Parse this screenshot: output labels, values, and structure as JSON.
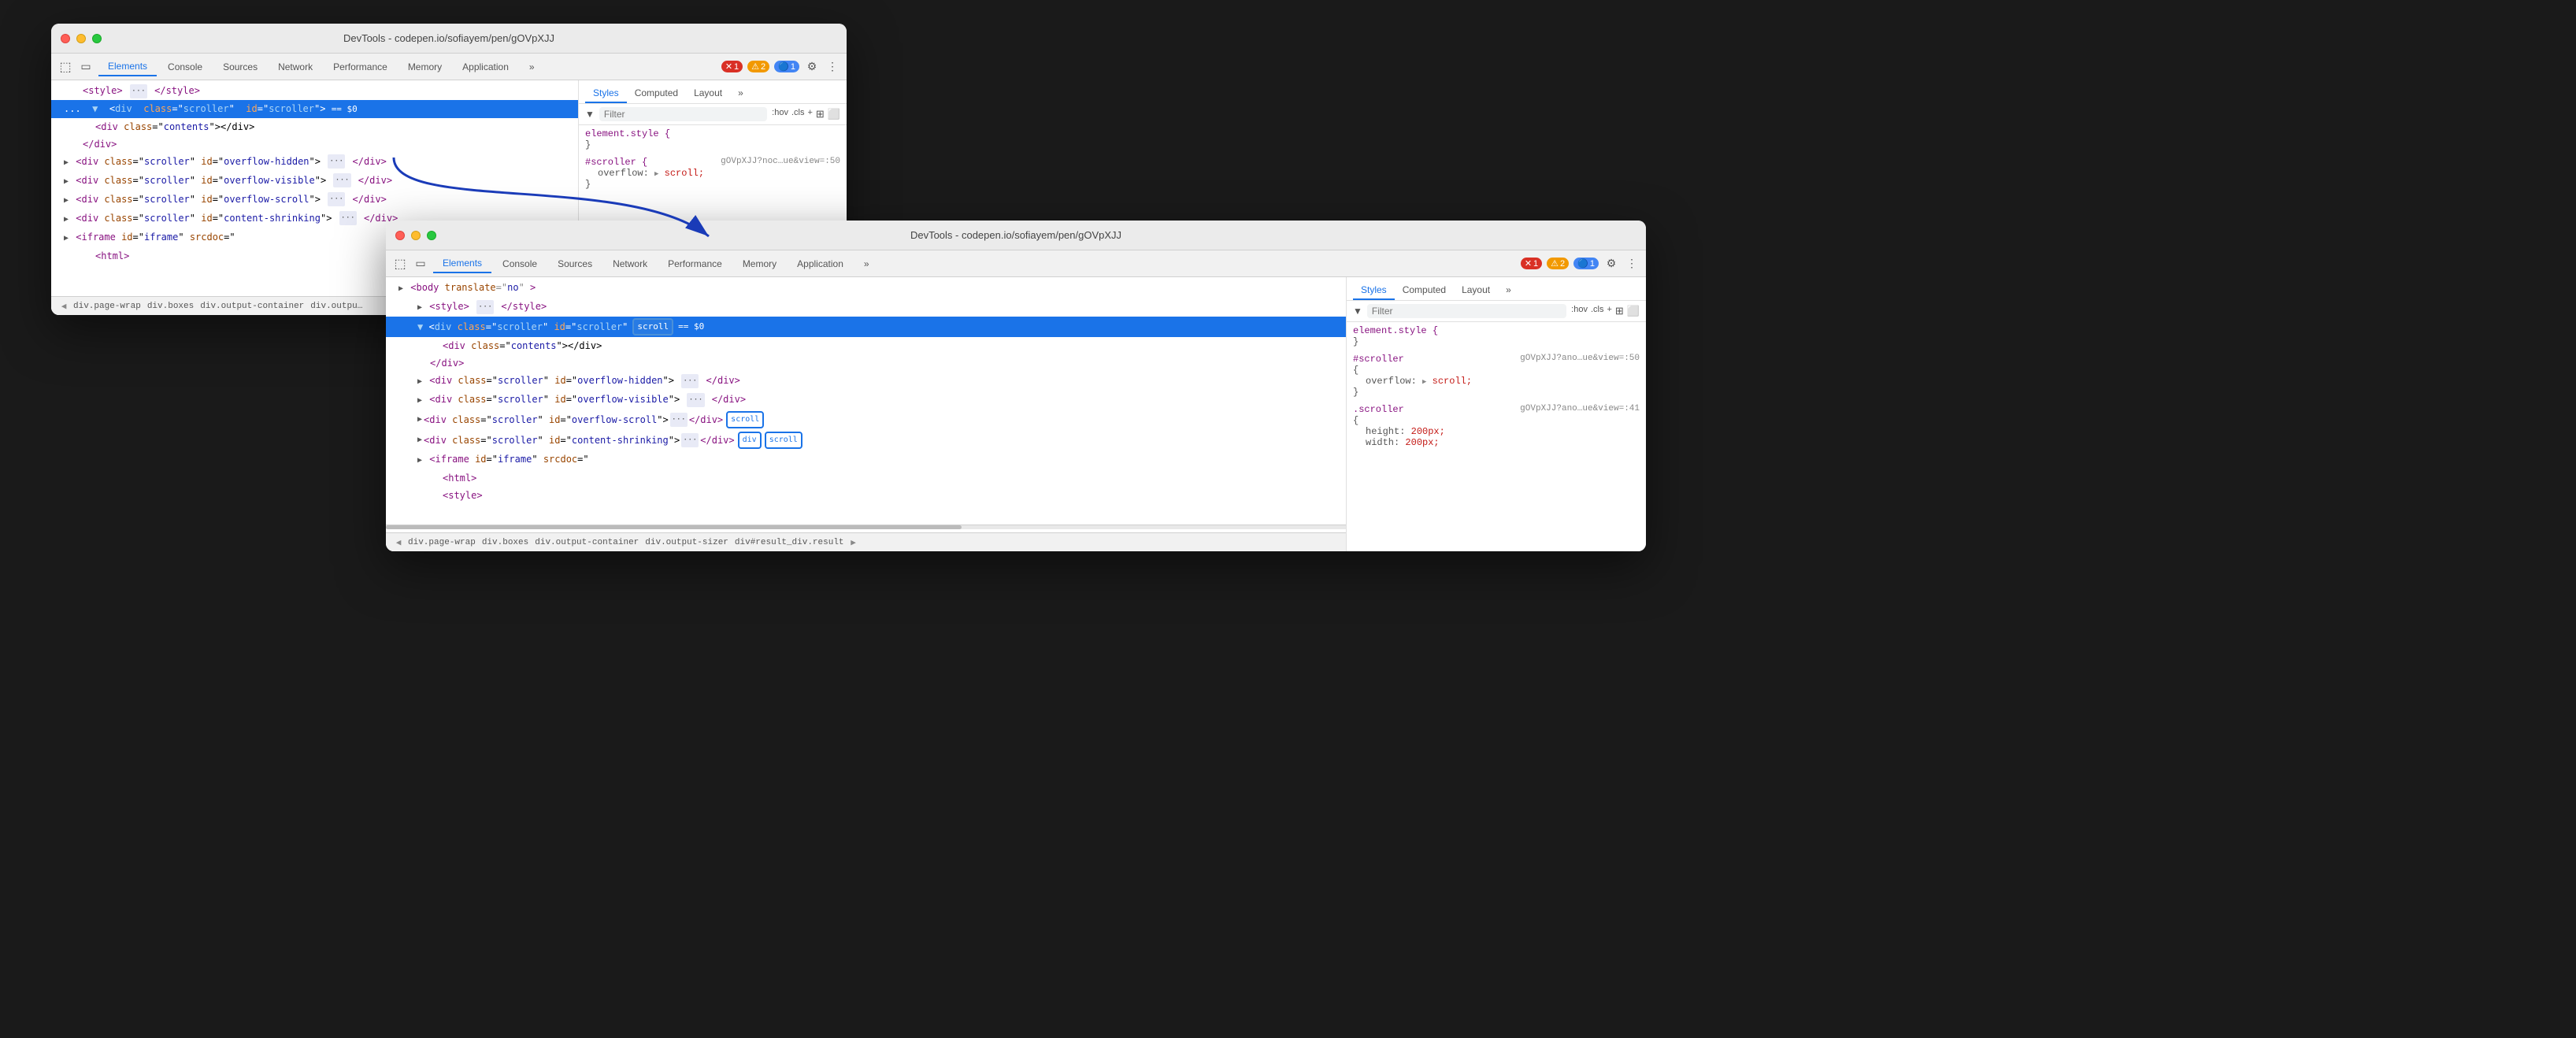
{
  "window1": {
    "title": "DevTools - codepen.io/sofiayem/pen/gOVpXJJ",
    "tabs": [
      "Elements",
      "Console",
      "Sources",
      "Network",
      "Performance",
      "Memory",
      "Application",
      ">>"
    ],
    "active_tab": "Elements",
    "errors": "1",
    "warnings": "2",
    "infos": "1"
  },
  "window2": {
    "title": "DevTools - codepen.io/sofiayem/pen/gOVpXJJ",
    "tabs": [
      "Elements",
      "Console",
      "Sources",
      "Network",
      "Performance",
      "Memory",
      "Application",
      ">>"
    ],
    "active_tab": "Elements",
    "errors": "1",
    "warnings": "2",
    "infos": "1"
  },
  "dom_lines": [
    {
      "indent": 0,
      "content": "▶ <style> ··· </style>",
      "selected": false
    },
    {
      "indent": 0,
      "content": "▼ <div class=\"scroller\" id=\"scroller\"> == $0",
      "selected": true,
      "has_scroll": false
    },
    {
      "indent": 1,
      "content": "<div class=\"contents\"></div>",
      "selected": false
    },
    {
      "indent": 0,
      "content": "</div>",
      "selected": false
    },
    {
      "indent": 0,
      "content": "▶ <div class=\"scroller\" id=\"overflow-hidden\"> ··· </div>",
      "selected": false
    },
    {
      "indent": 0,
      "content": "▶ <div class=\"scroller\" id=\"overflow-visible\"> ··· </div>",
      "selected": false
    },
    {
      "indent": 0,
      "content": "▶ <div class=\"scroller\" id=\"overflow-scroll\"> ··· </div>",
      "selected": false
    },
    {
      "indent": 0,
      "content": "▶ <div class=\"scroller\" id=\"content-shrinking\"> ··· </div>",
      "selected": false
    },
    {
      "indent": 0,
      "content": "▶ <iframe id=\"iframe\" srcdoc=\"",
      "selected": false
    },
    {
      "indent": 1,
      "content": "<html>",
      "selected": false
    }
  ],
  "dom_lines2": [
    {
      "indent": 0,
      "content": "▶ <style> ··· </style>",
      "selected": false
    },
    {
      "indent": 0,
      "content": "▼ <div class=\"scroller\" id=\"scroller\"",
      "selected": true,
      "has_scroll": true,
      "scroll_text": "scroll",
      "eq_dollar": "== $0"
    },
    {
      "indent": 1,
      "content": "<div class=\"contents\"></div>",
      "selected": false
    },
    {
      "indent": 0,
      "content": "</div>",
      "selected": false
    },
    {
      "indent": 0,
      "content": "▶ <div class=\"scroller\" id=\"overflow-hidden\"> ··· </div>",
      "selected": false
    },
    {
      "indent": 0,
      "content": "▶ <div class=\"scroller\" id=\"overflow-visible\"> ··· </div>",
      "selected": false
    },
    {
      "indent": 0,
      "content": "▶ <div class=\"scroller\" id=\"overflow-scroll\"> ··· </div>",
      "has_scroll2": true,
      "scroll_text2": "scroll",
      "selected": false
    },
    {
      "indent": 0,
      "content": "▶ <div class=\"scroller\" id=\"content-shrinking\"> ··· </div>",
      "has_div_scroll": true,
      "scroll_text3": "scroll",
      "selected": false
    },
    {
      "indent": 0,
      "content": "▶ <iframe id=\"iframe\" srcdoc=\"",
      "selected": false
    },
    {
      "indent": 1,
      "content": "<html>",
      "selected": false
    }
  ],
  "styles": {
    "filter_placeholder": "Filter",
    "pseudo_hov": ":hov",
    "pseudo_cls": ".cls",
    "rules": [
      {
        "selector": "element.style {",
        "close": "}",
        "source": "",
        "props": []
      },
      {
        "selector": "#scroller {",
        "source": "gOVpXJJ?noc…ue&view=:50",
        "close": "}",
        "props": [
          {
            "name": "overflow",
            "value": "▶ scroll;"
          }
        ]
      }
    ]
  },
  "styles2": {
    "filter_placeholder": "Filter",
    "pseudo_hov": ":hov",
    "pseudo_cls": ".cls",
    "rules": [
      {
        "selector": "element.style {",
        "close": "}",
        "source": "",
        "props": []
      },
      {
        "selector": "#scroller",
        "source": "gOVpXJJ?ano…ue&view=:50",
        "close": "",
        "props": [
          {
            "name": "overflow",
            "value": "▶ scroll;"
          }
        ]
      },
      {
        "selector": ".scroller",
        "source": "gOVpXJJ?ano…ue&view=:41",
        "close": "{",
        "props": [
          {
            "name": "height",
            "value": "200px;"
          },
          {
            "name": "width",
            "value": "200px;"
          }
        ]
      }
    ]
  },
  "breadcrumb1": [
    "div.page-wrap",
    "div.boxes",
    "div.output-container",
    "div.outpu…"
  ],
  "breadcrumb2": [
    "div.page-wrap",
    "div.boxes",
    "div.output-container",
    "div.output-sizer",
    "div#result_div.result"
  ]
}
